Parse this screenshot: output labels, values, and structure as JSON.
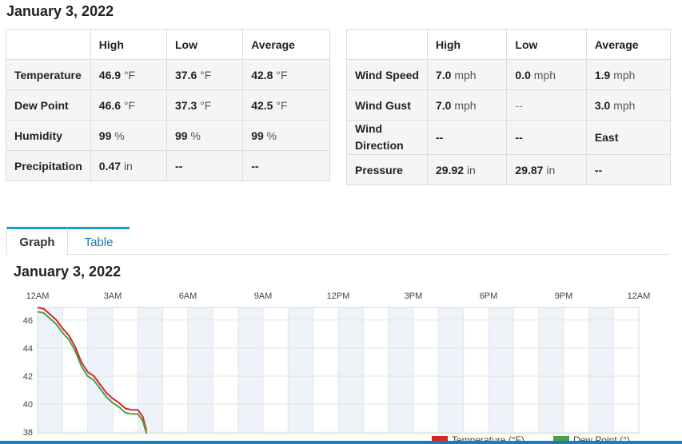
{
  "page": {
    "title": "January 3, 2022"
  },
  "left_table": {
    "headers": [
      "",
      "High",
      "Low",
      "Average"
    ],
    "rows": [
      {
        "label": "Temperature",
        "cells": [
          {
            "v": "46.9",
            "u": "°F"
          },
          {
            "v": "37.6",
            "u": "°F"
          },
          {
            "v": "42.8",
            "u": "°F"
          }
        ]
      },
      {
        "label": "Dew Point",
        "cells": [
          {
            "v": "46.6",
            "u": "°F"
          },
          {
            "v": "37.3",
            "u": "°F"
          },
          {
            "v": "42.5",
            "u": "°F"
          }
        ]
      },
      {
        "label": "Humidity",
        "cells": [
          {
            "v": "99",
            "u": "%"
          },
          {
            "v": "99",
            "u": "%"
          },
          {
            "v": "99",
            "u": "%"
          }
        ]
      },
      {
        "label": "Precipitation",
        "cells": [
          {
            "v": "0.47",
            "u": "in"
          },
          {
            "v": "--",
            "u": ""
          },
          {
            "v": "--",
            "u": ""
          }
        ]
      }
    ]
  },
  "right_table": {
    "headers": [
      "",
      "High",
      "Low",
      "Average"
    ],
    "rows": [
      {
        "label": "Wind Speed",
        "cells": [
          {
            "v": "7.0",
            "u": "mph"
          },
          {
            "v": "0.0",
            "u": "mph"
          },
          {
            "v": "1.9",
            "u": "mph"
          }
        ]
      },
      {
        "label": "Wind Gust",
        "cells": [
          {
            "v": "7.0",
            "u": "mph"
          },
          {
            "v": "--",
            "u": "",
            "plain": true
          },
          {
            "v": "3.0",
            "u": "mph"
          }
        ]
      },
      {
        "label": "Wind Direction",
        "cells": [
          {
            "v": "--",
            "u": ""
          },
          {
            "v": "--",
            "u": ""
          },
          {
            "v": "East",
            "u": ""
          }
        ]
      },
      {
        "label": "Pressure",
        "cells": [
          {
            "v": "29.92",
            "u": "in"
          },
          {
            "v": "29.87",
            "u": "in"
          },
          {
            "v": "--",
            "u": ""
          }
        ]
      }
    ]
  },
  "tabs": {
    "graph": "Graph",
    "table": "Table",
    "active": "graph"
  },
  "graph": {
    "title": "January 3, 2022"
  },
  "chart_data": {
    "type": "line",
    "x_ticks": [
      "12AM",
      "3AM",
      "6AM",
      "9AM",
      "12PM",
      "3PM",
      "6PM",
      "9PM",
      "12AM"
    ],
    "x_range_hours": [
      0,
      24
    ],
    "y_ticks": [
      38,
      40,
      42,
      44,
      46
    ],
    "ylim": [
      37.9,
      46.9
    ],
    "grid": true,
    "legend_position": "bottom-right",
    "series": [
      {
        "name": "Temperature (°F)",
        "color": "#d62728",
        "points": [
          [
            0.0,
            46.9
          ],
          [
            0.25,
            46.8
          ],
          [
            0.5,
            46.4
          ],
          [
            0.75,
            46.0
          ],
          [
            1.0,
            45.4
          ],
          [
            1.25,
            44.9
          ],
          [
            1.5,
            44.1
          ],
          [
            1.75,
            43.0
          ],
          [
            2.0,
            42.3
          ],
          [
            2.25,
            42.0
          ],
          [
            2.5,
            41.4
          ],
          [
            2.75,
            40.8
          ],
          [
            3.0,
            40.4
          ],
          [
            3.25,
            40.1
          ],
          [
            3.5,
            39.7
          ],
          [
            3.75,
            39.6
          ],
          [
            4.0,
            39.6
          ],
          [
            4.2,
            39.1
          ],
          [
            4.35,
            38.1
          ]
        ]
      },
      {
        "name": "Dew Point (°)",
        "color": "#4aa04a",
        "points": [
          [
            0.0,
            46.6
          ],
          [
            0.25,
            46.5
          ],
          [
            0.5,
            46.1
          ],
          [
            0.75,
            45.7
          ],
          [
            1.0,
            45.1
          ],
          [
            1.25,
            44.6
          ],
          [
            1.5,
            43.8
          ],
          [
            1.75,
            42.7
          ],
          [
            2.0,
            42.0
          ],
          [
            2.25,
            41.7
          ],
          [
            2.5,
            41.1
          ],
          [
            2.75,
            40.5
          ],
          [
            3.0,
            40.1
          ],
          [
            3.25,
            39.8
          ],
          [
            3.5,
            39.4
          ],
          [
            3.75,
            39.3
          ],
          [
            4.0,
            39.3
          ],
          [
            4.2,
            38.8
          ],
          [
            4.35,
            37.9
          ]
        ]
      }
    ]
  }
}
